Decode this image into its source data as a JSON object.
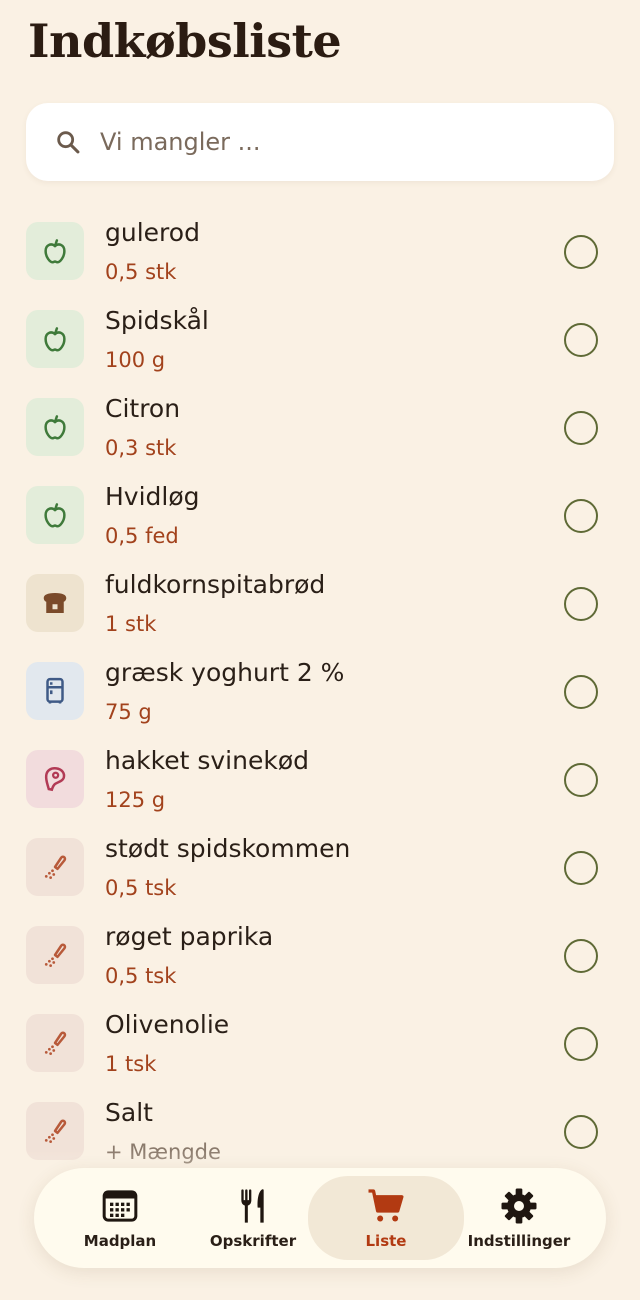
{
  "header": {
    "title": "Indkøbsliste"
  },
  "search": {
    "placeholder": "Vi mangler ..."
  },
  "items": [
    {
      "name": "gulerod",
      "quantity": "0,5 stk",
      "category_icon": "apple-icon",
      "checked": false
    },
    {
      "name": "Spidskål",
      "quantity": "100 g",
      "category_icon": "apple-icon",
      "checked": false
    },
    {
      "name": "Citron",
      "quantity": "0,3 stk",
      "category_icon": "apple-icon",
      "checked": false
    },
    {
      "name": "Hvidløg",
      "quantity": "0,5 fed",
      "category_icon": "apple-icon",
      "checked": false
    },
    {
      "name": "fuldkornspitabrød",
      "quantity": "1 stk",
      "category_icon": "bread-icon",
      "checked": false
    },
    {
      "name": "græsk yoghurt 2 %",
      "quantity": "75 g",
      "category_icon": "fridge-icon",
      "checked": false
    },
    {
      "name": "hakket svinekød",
      "quantity": "125 g",
      "category_icon": "meat-icon",
      "checked": false
    },
    {
      "name": "stødt spidskommen",
      "quantity": "0,5 tsk",
      "category_icon": "spice-shaker-icon",
      "checked": false
    },
    {
      "name": "røget paprika",
      "quantity": "0,5 tsk",
      "category_icon": "spice-shaker-icon",
      "checked": false
    },
    {
      "name": "Olivenolie",
      "quantity": "1 tsk",
      "category_icon": "spice-shaker-icon",
      "checked": false
    },
    {
      "name": "Salt",
      "quantity": "+ Mængde",
      "category_icon": "spice-shaker-icon",
      "checked": false
    }
  ],
  "nav": [
    {
      "label": "Madplan",
      "icon": "calendar-icon",
      "active": false
    },
    {
      "label": "Opskrifter",
      "icon": "fork-knife-icon",
      "active": false
    },
    {
      "label": "Liste",
      "icon": "cart-icon",
      "active": true
    },
    {
      "label": "Indstillinger",
      "icon": "gear-icon",
      "active": false
    }
  ],
  "colors": {
    "background": "#FAF1E4",
    "accent": "#B23A12",
    "quantity": "#A2421C",
    "checkbox": "#5f6a36",
    "produce_tile": "#E3EDDA",
    "bakery_tile": "#EEE3CF",
    "dairy_tile": "#E2E8EE",
    "meat_tile": "#F2DCDD",
    "spice_tile": "#F1E2D8"
  }
}
